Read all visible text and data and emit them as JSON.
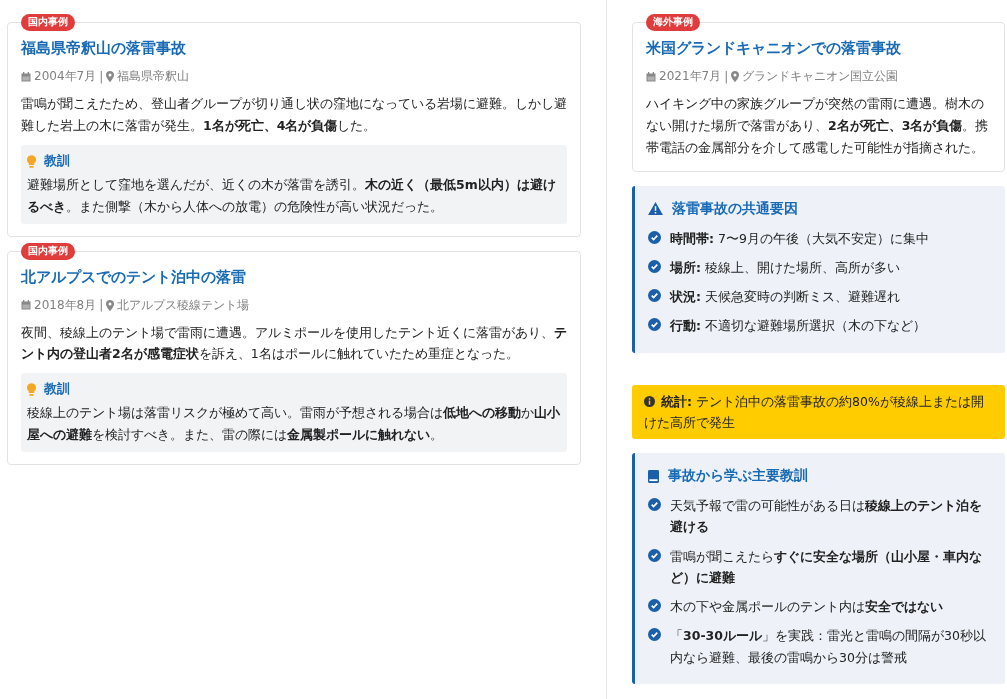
{
  "cases_left": [
    {
      "badge": "国内事例",
      "title": "福島県帝釈山の落雷事故",
      "date": "2004年7月",
      "separator": "|",
      "place": "福島県帝釈山",
      "body": "雷鳴が聞こえたため、登山者グループが切り通し状の窪地になっている岩場に避難。しかし避難した岩上の木に落雷が発生。**1名が死亡、4名が負傷**した。",
      "lesson": {
        "title": "教訓",
        "text": "避難場所として窪地を選んだが、近くの木が落雷を誘引。**木の近く（最低5m以内）は避けるべき**。また側撃（木から人体への放電）の危険性が高い状況だった。"
      }
    },
    {
      "badge": "国内事例",
      "title": "北アルプスでのテント泊中の落雷",
      "date": "2018年8月",
      "separator": "|",
      "place": "北アルプス稜線テント場",
      "body": "夜間、稜線上のテント場で雷雨に遭遇。アルミポールを使用したテント近くに落雷があり、**テント内の登山者2名が感電症状**を訴え、1名はポールに触れていたため重症となった。",
      "lesson": {
        "title": "教訓",
        "text": "稜線上のテント場は落雷リスクが極めて高い。雷雨が予想される場合は**低地への移動**か**山小屋への避難**を検討すべき。また、雷の際には**金属製ポールに触れない**。"
      }
    }
  ],
  "cases_right": [
    {
      "badge": "海外事例",
      "title": "米国グランドキャニオンでの落雷事故",
      "date": "2021年7月",
      "separator": "|",
      "place": "グランドキャニオン国立公園",
      "body": "ハイキング中の家族グループが突然の雷雨に遭遇。樹木のない開けた場所で落雷があり、**2名が死亡、3名が負傷**。携帯電話の金属部分を介して感電した可能性が指摘された。"
    }
  ],
  "factors": {
    "title": "落雷事故の共通要因",
    "items": [
      "**時間帯:** 7〜9月の午後（大気不安定）に集中",
      "**場所:** 稜線上、開けた場所、高所が多い",
      "**状況:** 天候急変時の判断ミス、避難遅れ",
      "**行動:** 不適切な避難場所選択（木の下など）"
    ]
  },
  "stat": "**統計:** テント泊中の落雷事故の約80%が稜線上または開けた高所で発生",
  "lessons": {
    "title": "事故から学ぶ主要教訓",
    "items": [
      "天気予報で雷の可能性がある日は**稜線上のテント泊を避ける**",
      "雷鳴が聞こえたら**すぐに安全な場所（山小屋・車内など）に避難**",
      "木の下や金属ポールのテント内は**安全ではない**",
      "「**30-30ルール**」を実践：雷光と雷鳴の間隔が30秒以内なら避難、最後の雷鳴から30分は警戒"
    ]
  }
}
